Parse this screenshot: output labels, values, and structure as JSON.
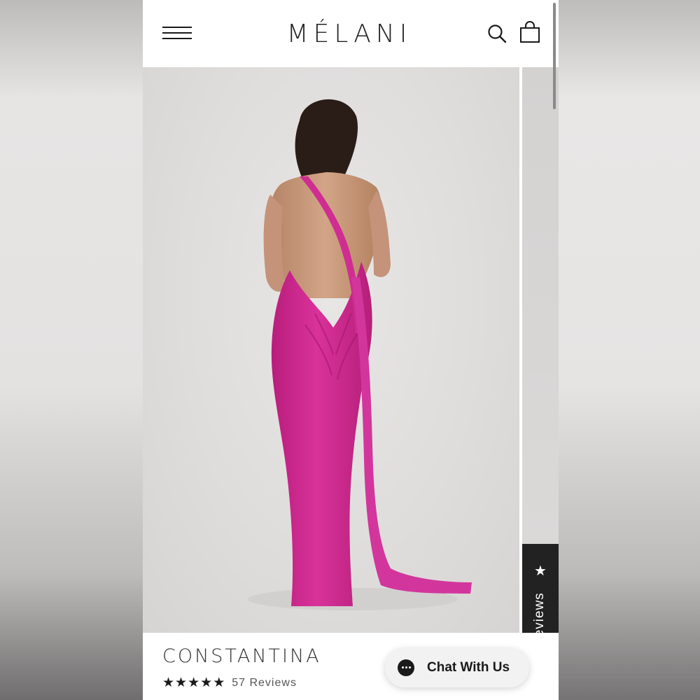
{
  "brand": {
    "logo": "MÉLANI"
  },
  "header": {
    "menu_icon": "hamburger-menu-icon",
    "search_icon": "search-icon",
    "cart_icon": "shopping-bag-icon"
  },
  "gallery": {
    "image_subject": "product-photo",
    "colors": {
      "dress": "#d1278f",
      "backdrop": "#e2e0df"
    }
  },
  "reviews_tab": {
    "label": "Reviews",
    "icon": "star-icon"
  },
  "product": {
    "name": "CONSTANTINA",
    "rating": 5,
    "max_rating": 5,
    "reviews_count": "57 Reviews"
  },
  "chat": {
    "label": "Chat With Us",
    "icon": "chat-bubble-icon"
  }
}
